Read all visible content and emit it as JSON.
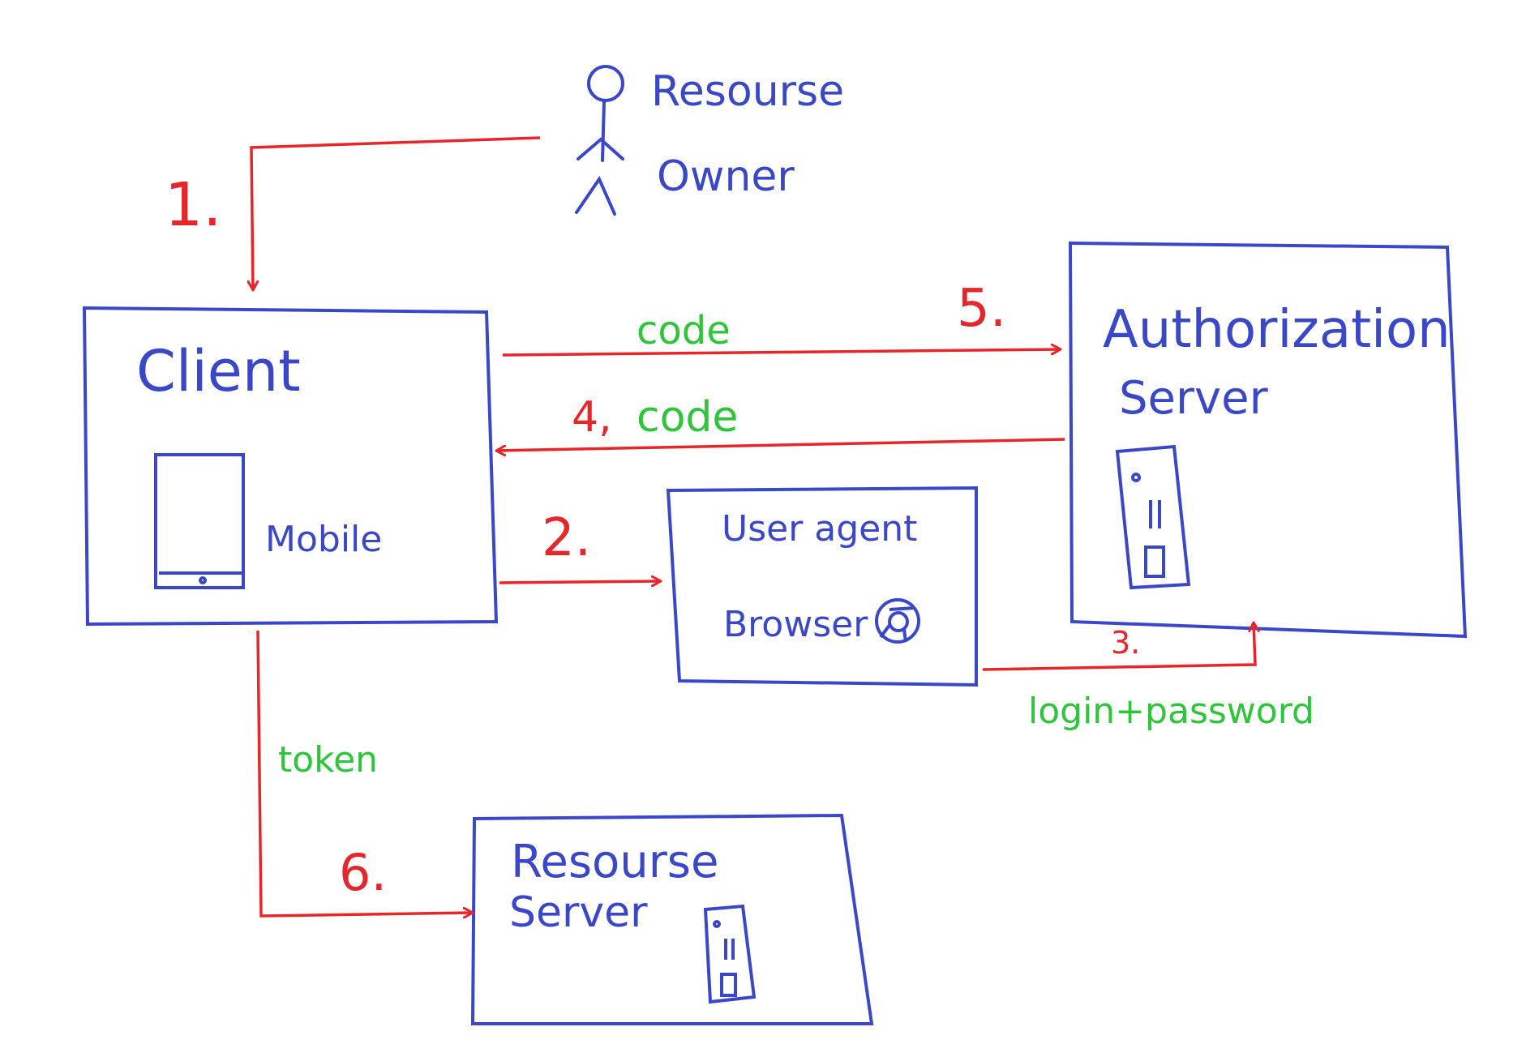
{
  "colors": {
    "box_stroke": "#3a48c8",
    "arrow": "#e5262a",
    "payload_label": "#2ec53a",
    "background": "#ffffff"
  },
  "nodes": {
    "resource_owner": {
      "line1": "Resourse",
      "line2": "Owner"
    },
    "client": {
      "title": "Client",
      "device_label": "Mobile"
    },
    "authorization_server": {
      "line1": "Authorization",
      "line2": "Server"
    },
    "user_agent": {
      "title": "User agent",
      "browser_label": "Browser"
    },
    "resource_server": {
      "line1": "Resourse",
      "line2": "Server"
    }
  },
  "edges": {
    "step1": {
      "number": "1."
    },
    "step2": {
      "number": "2."
    },
    "step3": {
      "number": "3.",
      "payload": "login+password"
    },
    "step4": {
      "number": "4,",
      "payload": "code"
    },
    "step5": {
      "number": "5.",
      "payload": "code"
    },
    "step6": {
      "number": "6.",
      "payload": "token"
    }
  }
}
